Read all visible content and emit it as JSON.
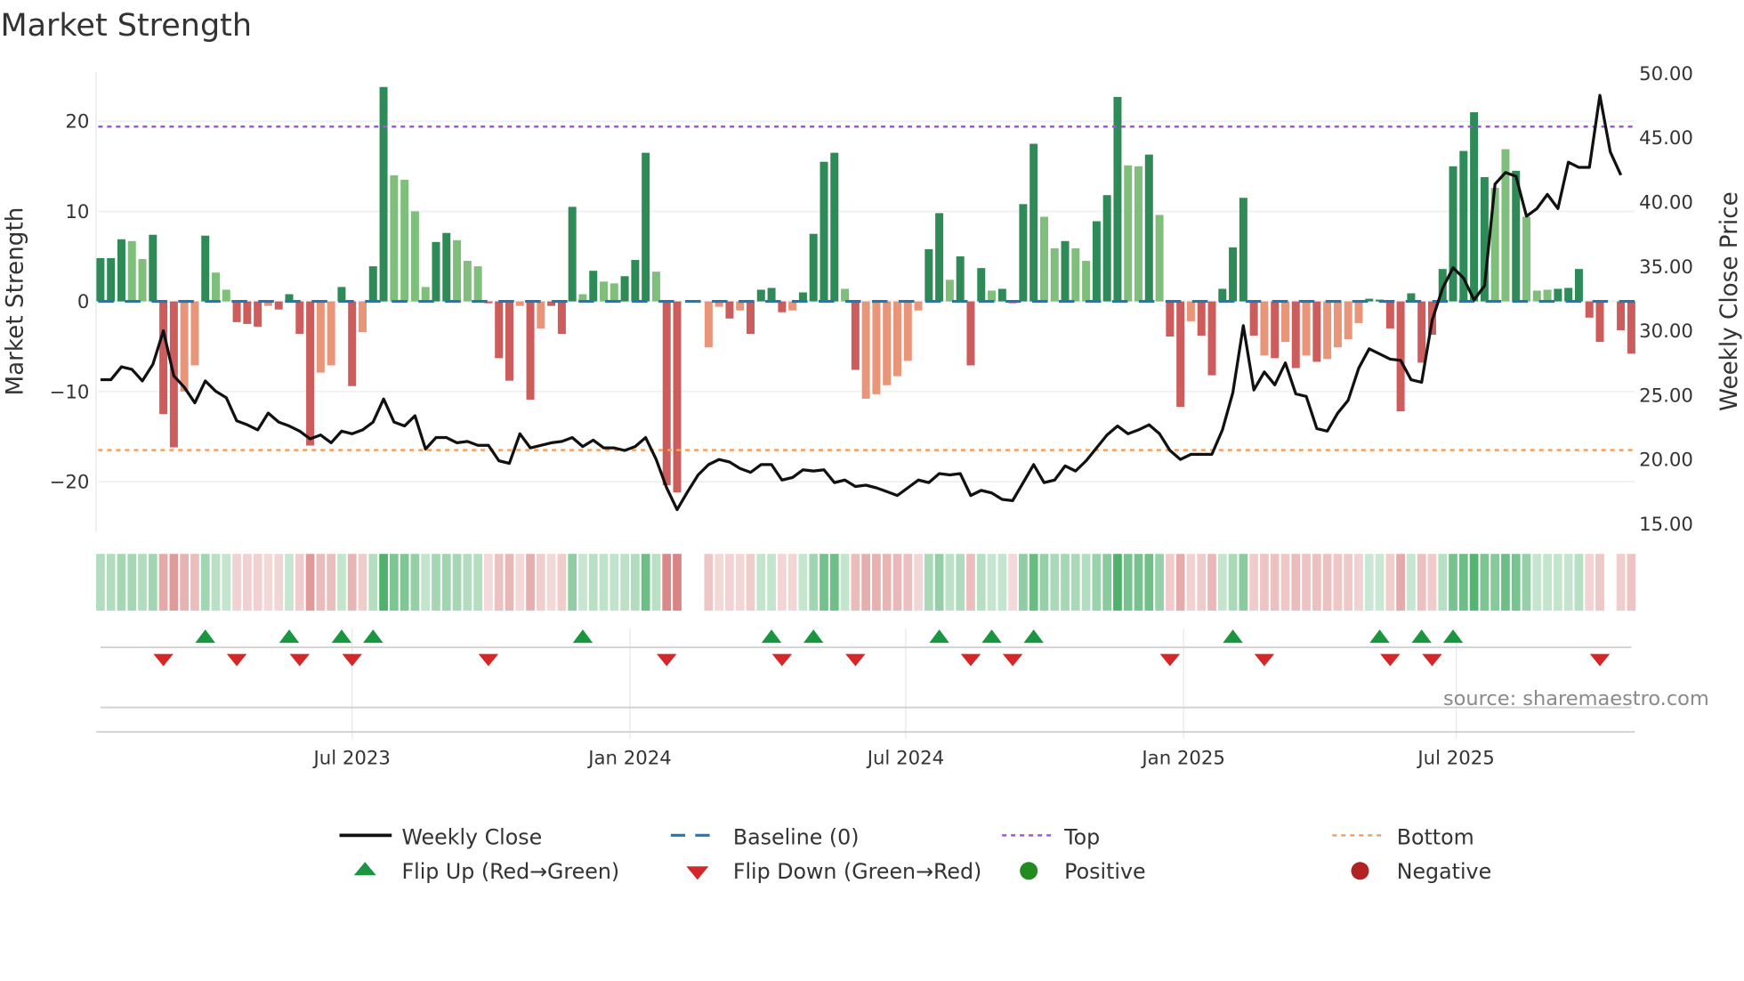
{
  "chart_data": {
    "type": "bar",
    "title": "Market Strength",
    "ylabel": "Market Strength",
    "y2label": "Weekly Close Price",
    "ylim": [
      -25.5,
      25.5
    ],
    "y2lim": [
      14.5,
      50.5
    ],
    "yticks": [
      20,
      10,
      0,
      -10,
      -20
    ],
    "ytick_labels": [
      "20",
      "10",
      "0",
      "−10",
      "−20"
    ],
    "y2ticks": [
      50,
      45,
      40,
      35,
      30,
      25,
      20,
      15
    ],
    "y2tick_labels": [
      "50.00",
      "45.00",
      "40.00",
      "35.00",
      "30.00",
      "25.00",
      "20.00",
      "15.00"
    ],
    "x_unit": "week index",
    "x_start": "2023-01-13",
    "xticks": [
      {
        "week": 24,
        "label": "Jul 2023"
      },
      {
        "week": 50.5,
        "label": "Jan 2024"
      },
      {
        "week": 76.8,
        "label": "Jul 2024"
      },
      {
        "week": 103.3,
        "label": "Jan 2025"
      },
      {
        "week": 129.3,
        "label": "Jul 2025"
      }
    ],
    "grid": true,
    "top_level": 19.4,
    "bottom_level": -16.5,
    "strength": [
      4.8,
      4.8,
      6.9,
      6.7,
      4.7,
      7.4,
      -12.5,
      -16.2,
      -10,
      -7.1,
      7.3,
      3.2,
      1.3,
      -2.3,
      -2.5,
      -2.8,
      -0.5,
      -0.9,
      0.8,
      -3.6,
      -16,
      -7.9,
      -7.1,
      1.6,
      -9.4,
      -3.4,
      3.9,
      23.8,
      14,
      13.5,
      10,
      1.6,
      6.6,
      7.6,
      6.8,
      4.5,
      3.9,
      -0.2,
      -6.3,
      -8.8,
      -0.5,
      -10.9,
      -3,
      -0.5,
      -3.6,
      10.5,
      0.8,
      3.4,
      2.2,
      2,
      2.8,
      4.6,
      16.5,
      3.3,
      -20.4,
      -21.2,
      0,
      0,
      -5.1,
      -0.6,
      -1.9,
      -1,
      -3.6,
      1.3,
      1.5,
      -1.2,
      -1,
      1,
      7.5,
      15.5,
      16.5,
      1.4,
      -7.6,
      -10.8,
      -10.3,
      -9.3,
      -8.3,
      -6.6,
      -1,
      5.8,
      9.8,
      2.4,
      5,
      -7.1,
      3.7,
      1.2,
      1.4,
      -0.2,
      10.8,
      17.5,
      9.4,
      5.9,
      6.7,
      5.9,
      4.5,
      8.9,
      11.8,
      22.7,
      15.1,
      15,
      16.3,
      9.6,
      -3.9,
      -11.7,
      -2.2,
      -3.8,
      -8.2,
      1.4,
      6,
      11.5,
      -3.8,
      -6,
      -6.3,
      -4.5,
      -7.4,
      -6,
      -6.7,
      -6.4,
      -5.1,
      -4.2,
      -2.4,
      0.3,
      0.2,
      -3,
      -12.2,
      0.9,
      -6.8,
      -3.7,
      3.6,
      15,
      16.7,
      21,
      13.8,
      12.6,
      16.9,
      14.5,
      9.4,
      1.2,
      1.3,
      1.4,
      1.5,
      3.6,
      -1.8,
      -4.5,
      0,
      -3.2,
      -5.8
    ],
    "strength_shade": "DDDLLDRROODLLRRRORDRROODROD DLLLLDDLLLRRRORORRDLDLLDDDLRR__OOROR DDROD DDDLROOOOOODDLDRDLDRDDLLDLLDDDLLDLRRORRDDDROROROROOOOODLRRDROD DDDLLDLLLDDDDRR_RR",
    "weekly_close": [
      26.2,
      26.2,
      27.2,
      27.0,
      26.1,
      27.4,
      30.0,
      26.5,
      25.6,
      24.4,
      26.1,
      25.3,
      24.8,
      23.0,
      22.7,
      22.3,
      23.6,
      22.9,
      22.6,
      22.2,
      21.6,
      21.9,
      21.3,
      22.2,
      22.0,
      22.3,
      22.9,
      24.7,
      22.9,
      22.6,
      23.4,
      20.8,
      21.7,
      21.7,
      21.3,
      21.4,
      21.1,
      21.1,
      19.9,
      19.7,
      22.0,
      20.9,
      21.1,
      21.3,
      21.4,
      21.7,
      21.0,
      21.5,
      20.9,
      20.9,
      20.7,
      21.0,
      21.7,
      20.0,
      17.8,
      16.1,
      17.5,
      18.8,
      19.6,
      20.0,
      19.8,
      19.3,
      19.0,
      19.6,
      19.6,
      18.4,
      18.6,
      19.2,
      19.1,
      19.2,
      18.2,
      18.4,
      17.9,
      18.0,
      17.8,
      17.5,
      17.2,
      17.8,
      18.4,
      18.2,
      18.9,
      18.8,
      18.9,
      17.2,
      17.6,
      17.4,
      16.9,
      16.8,
      18.2,
      19.6,
      18.2,
      18.4,
      19.5,
      19.1,
      19.9,
      20.9,
      21.9,
      22.6,
      22.0,
      22.3,
      22.7,
      22.0,
      20.7,
      20.0,
      20.4,
      20.4,
      20.4,
      22.3,
      25.2,
      30.4,
      25.4,
      26.8,
      25.8,
      27.5,
      25.1,
      24.9,
      22.4,
      22.2,
      23.6,
      24.6,
      27.1,
      28.6,
      28.2,
      27.8,
      27.7,
      26.2,
      26.0,
      30.8,
      33.3,
      34.9,
      34.1,
      32.4,
      33.5,
      41.4,
      42.3,
      42.0,
      38.9,
      39.5,
      40.6,
      39.5,
      43.1,
      42.7,
      42.7,
      48.3,
      43.9,
      42.1
    ],
    "flip_up_weeks": [
      10,
      18,
      23,
      26,
      46,
      64,
      68,
      80,
      85,
      89,
      108,
      122,
      126,
      129
    ],
    "flip_down_weeks": [
      6,
      13,
      19,
      24,
      37,
      54,
      65,
      72,
      83,
      87,
      102,
      111,
      123,
      127,
      143
    ],
    "colors": {
      "strong_positive": "#2e8b57",
      "weak_positive": "#7fbf7b",
      "strong_negative": "#cd5c5c",
      "weak_negative": "#e8957a",
      "close_line": "#111111",
      "baseline": "#1f77b4",
      "top": "#9b59d6",
      "bottom": "#f0a060",
      "flip_up": "#1a9641",
      "flip_down": "#d62728",
      "positive": "#228b22",
      "negative": "#b22222"
    },
    "legend": {
      "placement": "bottom-center",
      "weekly_close": "Weekly Close",
      "baseline": "Baseline (0)",
      "top": "Top",
      "bottom": "Bottom",
      "flip_up": "Flip Up (Red→Green)",
      "flip_down": "Flip Down (Green→Red)",
      "positive": "Positive",
      "negative": "Negative"
    },
    "source": "source: sharemaestro.com"
  }
}
